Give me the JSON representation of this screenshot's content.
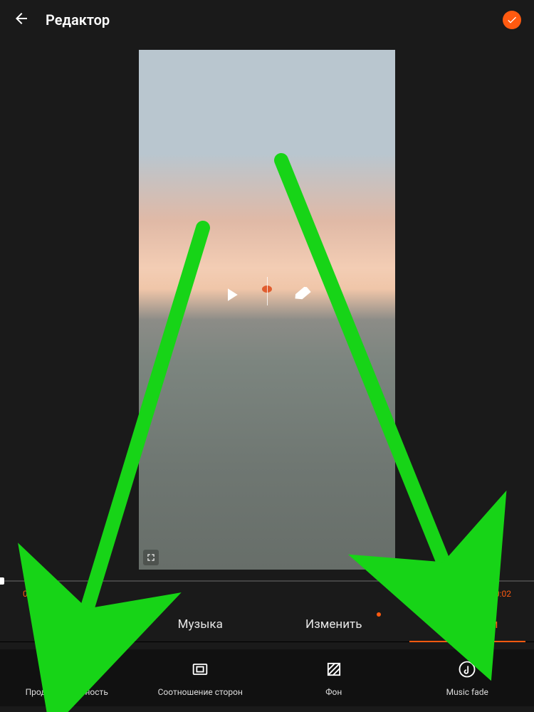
{
  "header": {
    "title": "Редактор"
  },
  "preview": {
    "play_icon": "play-icon",
    "erase_icon": "eraser-icon",
    "expand_icon": "expand-icon"
  },
  "timeline": {
    "start": "00:00",
    "end": "00:02"
  },
  "tabs": [
    {
      "id": "theme",
      "label": "Тема",
      "active": false,
      "dot": false
    },
    {
      "id": "music",
      "label": "Музыка",
      "active": false,
      "dot": false
    },
    {
      "id": "edit",
      "label": "Изменить",
      "active": false,
      "dot": true
    },
    {
      "id": "settings",
      "label": "Настройки",
      "active": true,
      "dot": false
    }
  ],
  "options": [
    {
      "id": "duration",
      "label": "Продолжительность",
      "icon": "clock-icon"
    },
    {
      "id": "ratio",
      "label": "Соотношение сторон",
      "icon": "aspect-ratio-icon"
    },
    {
      "id": "background",
      "label": "Фон",
      "icon": "hatch-icon"
    },
    {
      "id": "musicfade",
      "label": "Music fade",
      "icon": "music-fade-icon"
    }
  ],
  "colors": {
    "accent": "#ff5a10"
  }
}
